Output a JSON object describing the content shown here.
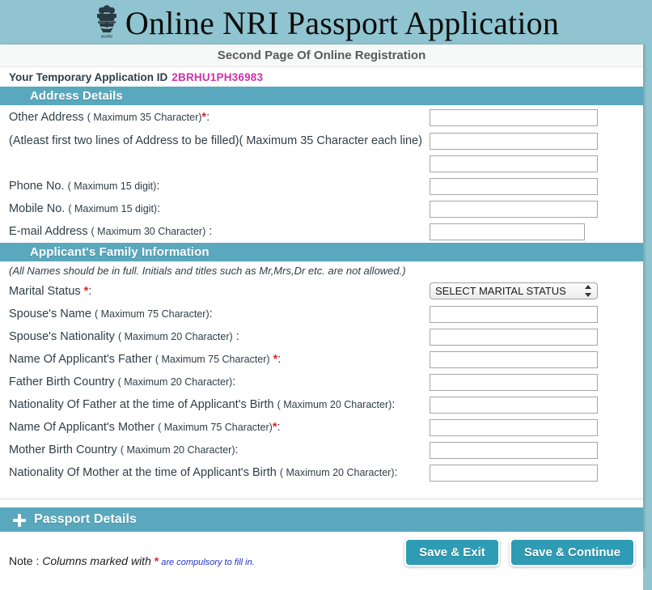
{
  "banner": {
    "emblem_icon": "india-state-emblem-icon",
    "title": "Online NRI Passport Application"
  },
  "page": {
    "subtitle": "Second Page Of Online Registration",
    "app_id_label": "Your Temporary Application ID",
    "app_id_value": "2BRHU1PH36983",
    "app_id_color": "#cc33aa"
  },
  "theme": {
    "banner_bg": "#8fc4d0",
    "section_bar_bg": "#59a8bd",
    "button_bg": "#2f9cb5",
    "required_color": "#d8262c",
    "note_link_color": "#2435c8"
  },
  "address_section": {
    "title": "Address Details",
    "fields": [
      {
        "label_main": "Other Address ",
        "label_small": "( Maximum 35 Character)",
        "required": true,
        "suffix": ":",
        "value": "",
        "placeholder": ""
      },
      {
        "label_main": "(Atleast first two lines of Address to be filled)( Maximum 35 Character each line)",
        "label_small": "",
        "required": false,
        "suffix": "",
        "value": "",
        "placeholder": ""
      },
      {
        "label_main": "",
        "label_small": "",
        "required": false,
        "suffix": "",
        "value": "",
        "placeholder": ""
      },
      {
        "label_main": "Phone No. ",
        "label_small": "( Maximum 15 digit)",
        "required": false,
        "suffix": ":",
        "value": "",
        "placeholder": ""
      },
      {
        "label_main": "Mobile No. ",
        "label_small": "( Maximum 15 digit)",
        "required": false,
        "suffix": ":",
        "value": "",
        "placeholder": ""
      },
      {
        "label_main": "E-mail Address ",
        "label_small": "( Maximum 30 Character)",
        "required": false,
        "suffix": " :",
        "value": "",
        "placeholder": ""
      }
    ]
  },
  "family_section": {
    "title": "Applicant's Family Information",
    "note": "(All Names should be in full. Initials and titles such as Mr,Mrs,Dr etc. are not allowed.)",
    "marital_status": {
      "label_main": "Marital Status ",
      "label_small": "",
      "required": true,
      "suffix": ":",
      "selected": "SELECT MARITAL STATUS",
      "options": [
        "SELECT MARITAL STATUS"
      ]
    },
    "fields": [
      {
        "label_main": "Spouse's Name ",
        "label_small": "( Maximum 75 Character)",
        "required": false,
        "suffix": ":",
        "value": "",
        "placeholder": ""
      },
      {
        "label_main": "Spouse's Nationality ",
        "label_small": "( Maximum 20 Character)",
        "required": false,
        "suffix": " :",
        "value": "",
        "placeholder": ""
      },
      {
        "label_main": "Name Of Applicant's Father ",
        "label_small": "( Maximum 75 Character)",
        "required": true,
        "suffix": ":",
        "value": "",
        "placeholder": ""
      },
      {
        "label_main": "Father Birth Country ",
        "label_small": "( Maximum 20 Character)",
        "required": false,
        "suffix": ":",
        "value": "",
        "placeholder": ""
      },
      {
        "label_main": "Nationality Of Father at the time of Applicant's Birth ",
        "label_small": "( Maximum 20 Character)",
        "required": false,
        "suffix": ":",
        "value": "",
        "placeholder": ""
      },
      {
        "label_main": "Name Of Applicant's Mother ",
        "label_small": "( Maximum 75 Character)",
        "required": true,
        "suffix": ":",
        "value": "",
        "placeholder": ""
      },
      {
        "label_main": "Mother Birth Country ",
        "label_small": "( Maximum 20 Character)",
        "required": false,
        "suffix": ":",
        "value": "",
        "placeholder": ""
      },
      {
        "label_main": "Nationality Of Mother at the time of Applicant's Birth ",
        "label_small": "( Maximum 20 Character)",
        "required": false,
        "suffix": ":",
        "value": "",
        "placeholder": ""
      }
    ]
  },
  "passport_section": {
    "title": "Passport Details",
    "expand_icon": "plus-icon"
  },
  "footer": {
    "note_prefix": "Note : ",
    "note_italic": "Columns marked with ",
    "note_asterisk": "*",
    "note_blue": " are compulsory to fill in.",
    "buttons": [
      {
        "label": "Save & Exit",
        "name": "save-and-exit-button"
      },
      {
        "label": "Save & Continue",
        "name": "save-and-continue-button"
      }
    ]
  }
}
